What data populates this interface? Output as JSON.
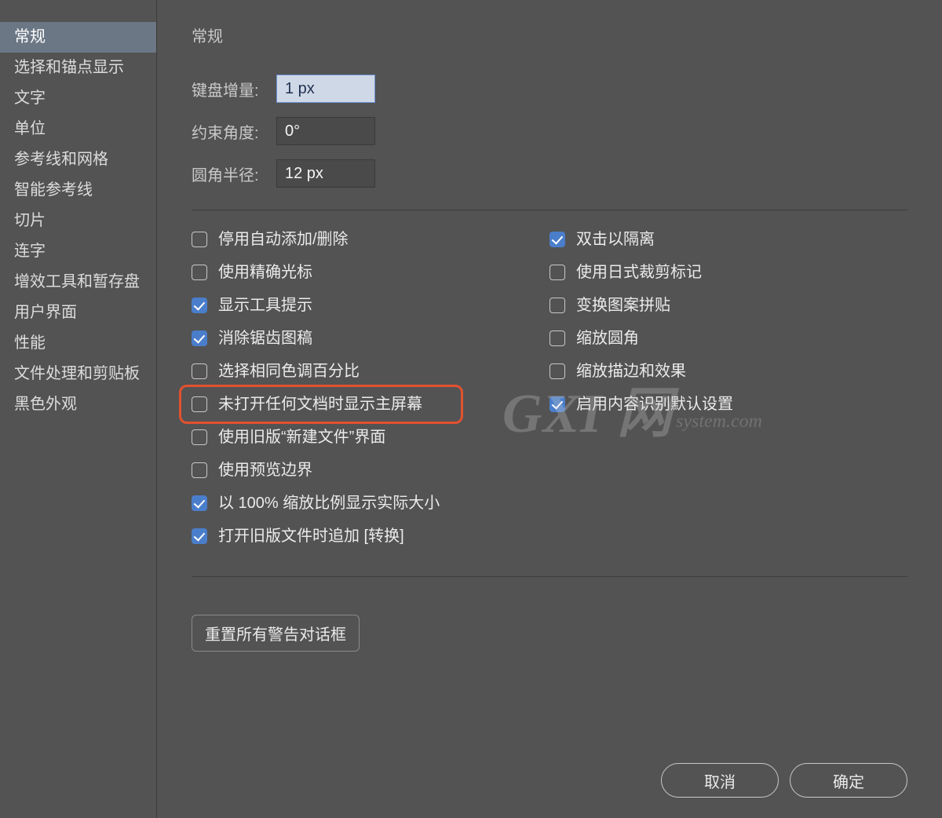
{
  "sidebar": {
    "items": [
      {
        "label": "常规",
        "selected": true
      },
      {
        "label": "选择和锚点显示",
        "selected": false
      },
      {
        "label": "文字",
        "selected": false
      },
      {
        "label": "单位",
        "selected": false
      },
      {
        "label": "参考线和网格",
        "selected": false
      },
      {
        "label": "智能参考线",
        "selected": false
      },
      {
        "label": "切片",
        "selected": false
      },
      {
        "label": "连字",
        "selected": false
      },
      {
        "label": "增效工具和暂存盘",
        "selected": false
      },
      {
        "label": "用户界面",
        "selected": false
      },
      {
        "label": "性能",
        "selected": false
      },
      {
        "label": "文件处理和剪贴板",
        "selected": false
      },
      {
        "label": "黑色外观",
        "selected": false
      }
    ]
  },
  "main": {
    "title": "常规",
    "fields": {
      "keyboard_increment": {
        "label": "键盘增量:",
        "value": "1 px"
      },
      "constrain_angle": {
        "label": "约束角度:",
        "value": "0°"
      },
      "corner_radius": {
        "label": "圆角半径:",
        "value": "12 px"
      }
    },
    "checks_left": [
      {
        "label": "停用自动添加/删除",
        "checked": false
      },
      {
        "label": "使用精确光标",
        "checked": false
      },
      {
        "label": "显示工具提示",
        "checked": true
      },
      {
        "label": "消除锯齿图稿",
        "checked": true
      },
      {
        "label": "选择相同色调百分比",
        "checked": false
      },
      {
        "label": "未打开任何文档时显示主屏幕",
        "checked": false,
        "highlight": true
      },
      {
        "label": "使用旧版“新建文件”界面",
        "checked": false
      },
      {
        "label": "使用预览边界",
        "checked": false
      },
      {
        "label": "以 100% 缩放比例显示实际大小",
        "checked": true
      },
      {
        "label": "打开旧版文件时追加 [转换]",
        "checked": true
      }
    ],
    "checks_right": [
      {
        "label": "双击以隔离",
        "checked": true
      },
      {
        "label": "使用日式裁剪标记",
        "checked": false
      },
      {
        "label": "变换图案拼贴",
        "checked": false
      },
      {
        "label": "缩放圆角",
        "checked": false
      },
      {
        "label": "缩放描边和效果",
        "checked": false
      },
      {
        "label": "启用内容识别默认设置",
        "checked": true
      }
    ],
    "reset_button": "重置所有警告对话框"
  },
  "buttons": {
    "cancel": "取消",
    "ok": "确定"
  },
  "watermark": {
    "big": "GXI 网",
    "small": "system.com"
  }
}
